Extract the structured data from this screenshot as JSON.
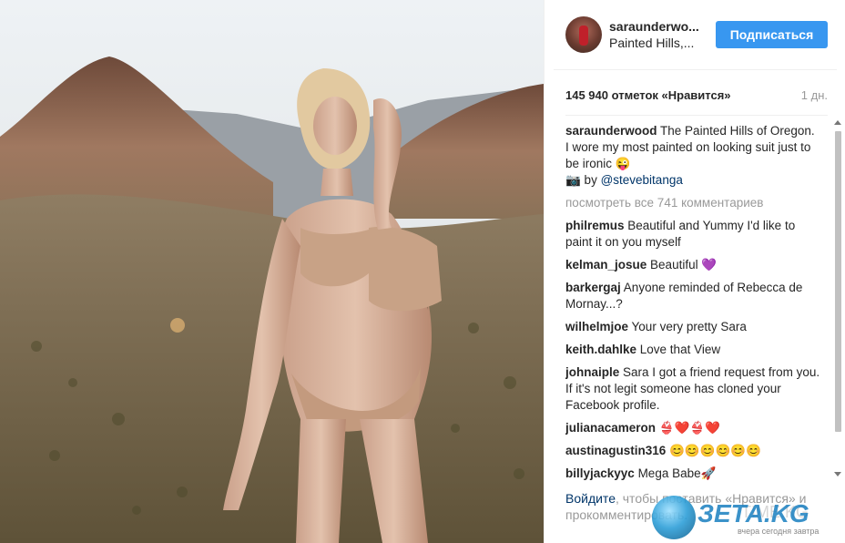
{
  "post": {
    "username": "saraunderwo...",
    "location": "Painted Hills,...",
    "follow_label": "Подписаться",
    "likes": "145 940 отметок «Нравится»",
    "time": "1 дн."
  },
  "caption": {
    "user": "saraunderwood",
    "text": " The Painted Hills of Oregon. I wore my most painted on looking suit just to be ironic 😜",
    "credit_prefix": "📷 by ",
    "credit_mention": "@stevebitanga"
  },
  "view_all": "посмотреть все 741 комментариев",
  "comments": [
    {
      "user": "philremus",
      "text": " Beautiful and Yummy I'd like to paint it on you myself"
    },
    {
      "user": "kelman_josue",
      "text": " Beautiful 💜"
    },
    {
      "user": "barkergaj",
      "text": " Anyone reminded of Rebecca de Mornay...?"
    },
    {
      "user": "wilhelmjoe",
      "text": " Your very pretty Sara"
    },
    {
      "user": "keith.dahlke",
      "text": " Love that View"
    },
    {
      "user": "johnaiple",
      "text": " Sara I got a friend request from you. If it's not legit someone has cloned your Facebook profile."
    },
    {
      "user": "julianacameron",
      "text": " 👙❤️👙❤️"
    },
    {
      "user": "austinagustin316",
      "text": " 😊😊😊😊😊😊"
    },
    {
      "user": "billyjackyyc",
      "text": " Mega Babe🚀"
    }
  ],
  "footer": {
    "login": "Войдите",
    "text": ", чтобы поставить «Нравится» и прокомментировать."
  },
  "watermark": {
    "logo": "ЗЕТА.KG",
    "tagline": "вчера сегодня завтра",
    "grey": "TIME.KG"
  },
  "icons": {
    "avatar": "profile-photo",
    "scroll_up": "arrow-up-icon",
    "scroll_down": "arrow-down-icon"
  }
}
